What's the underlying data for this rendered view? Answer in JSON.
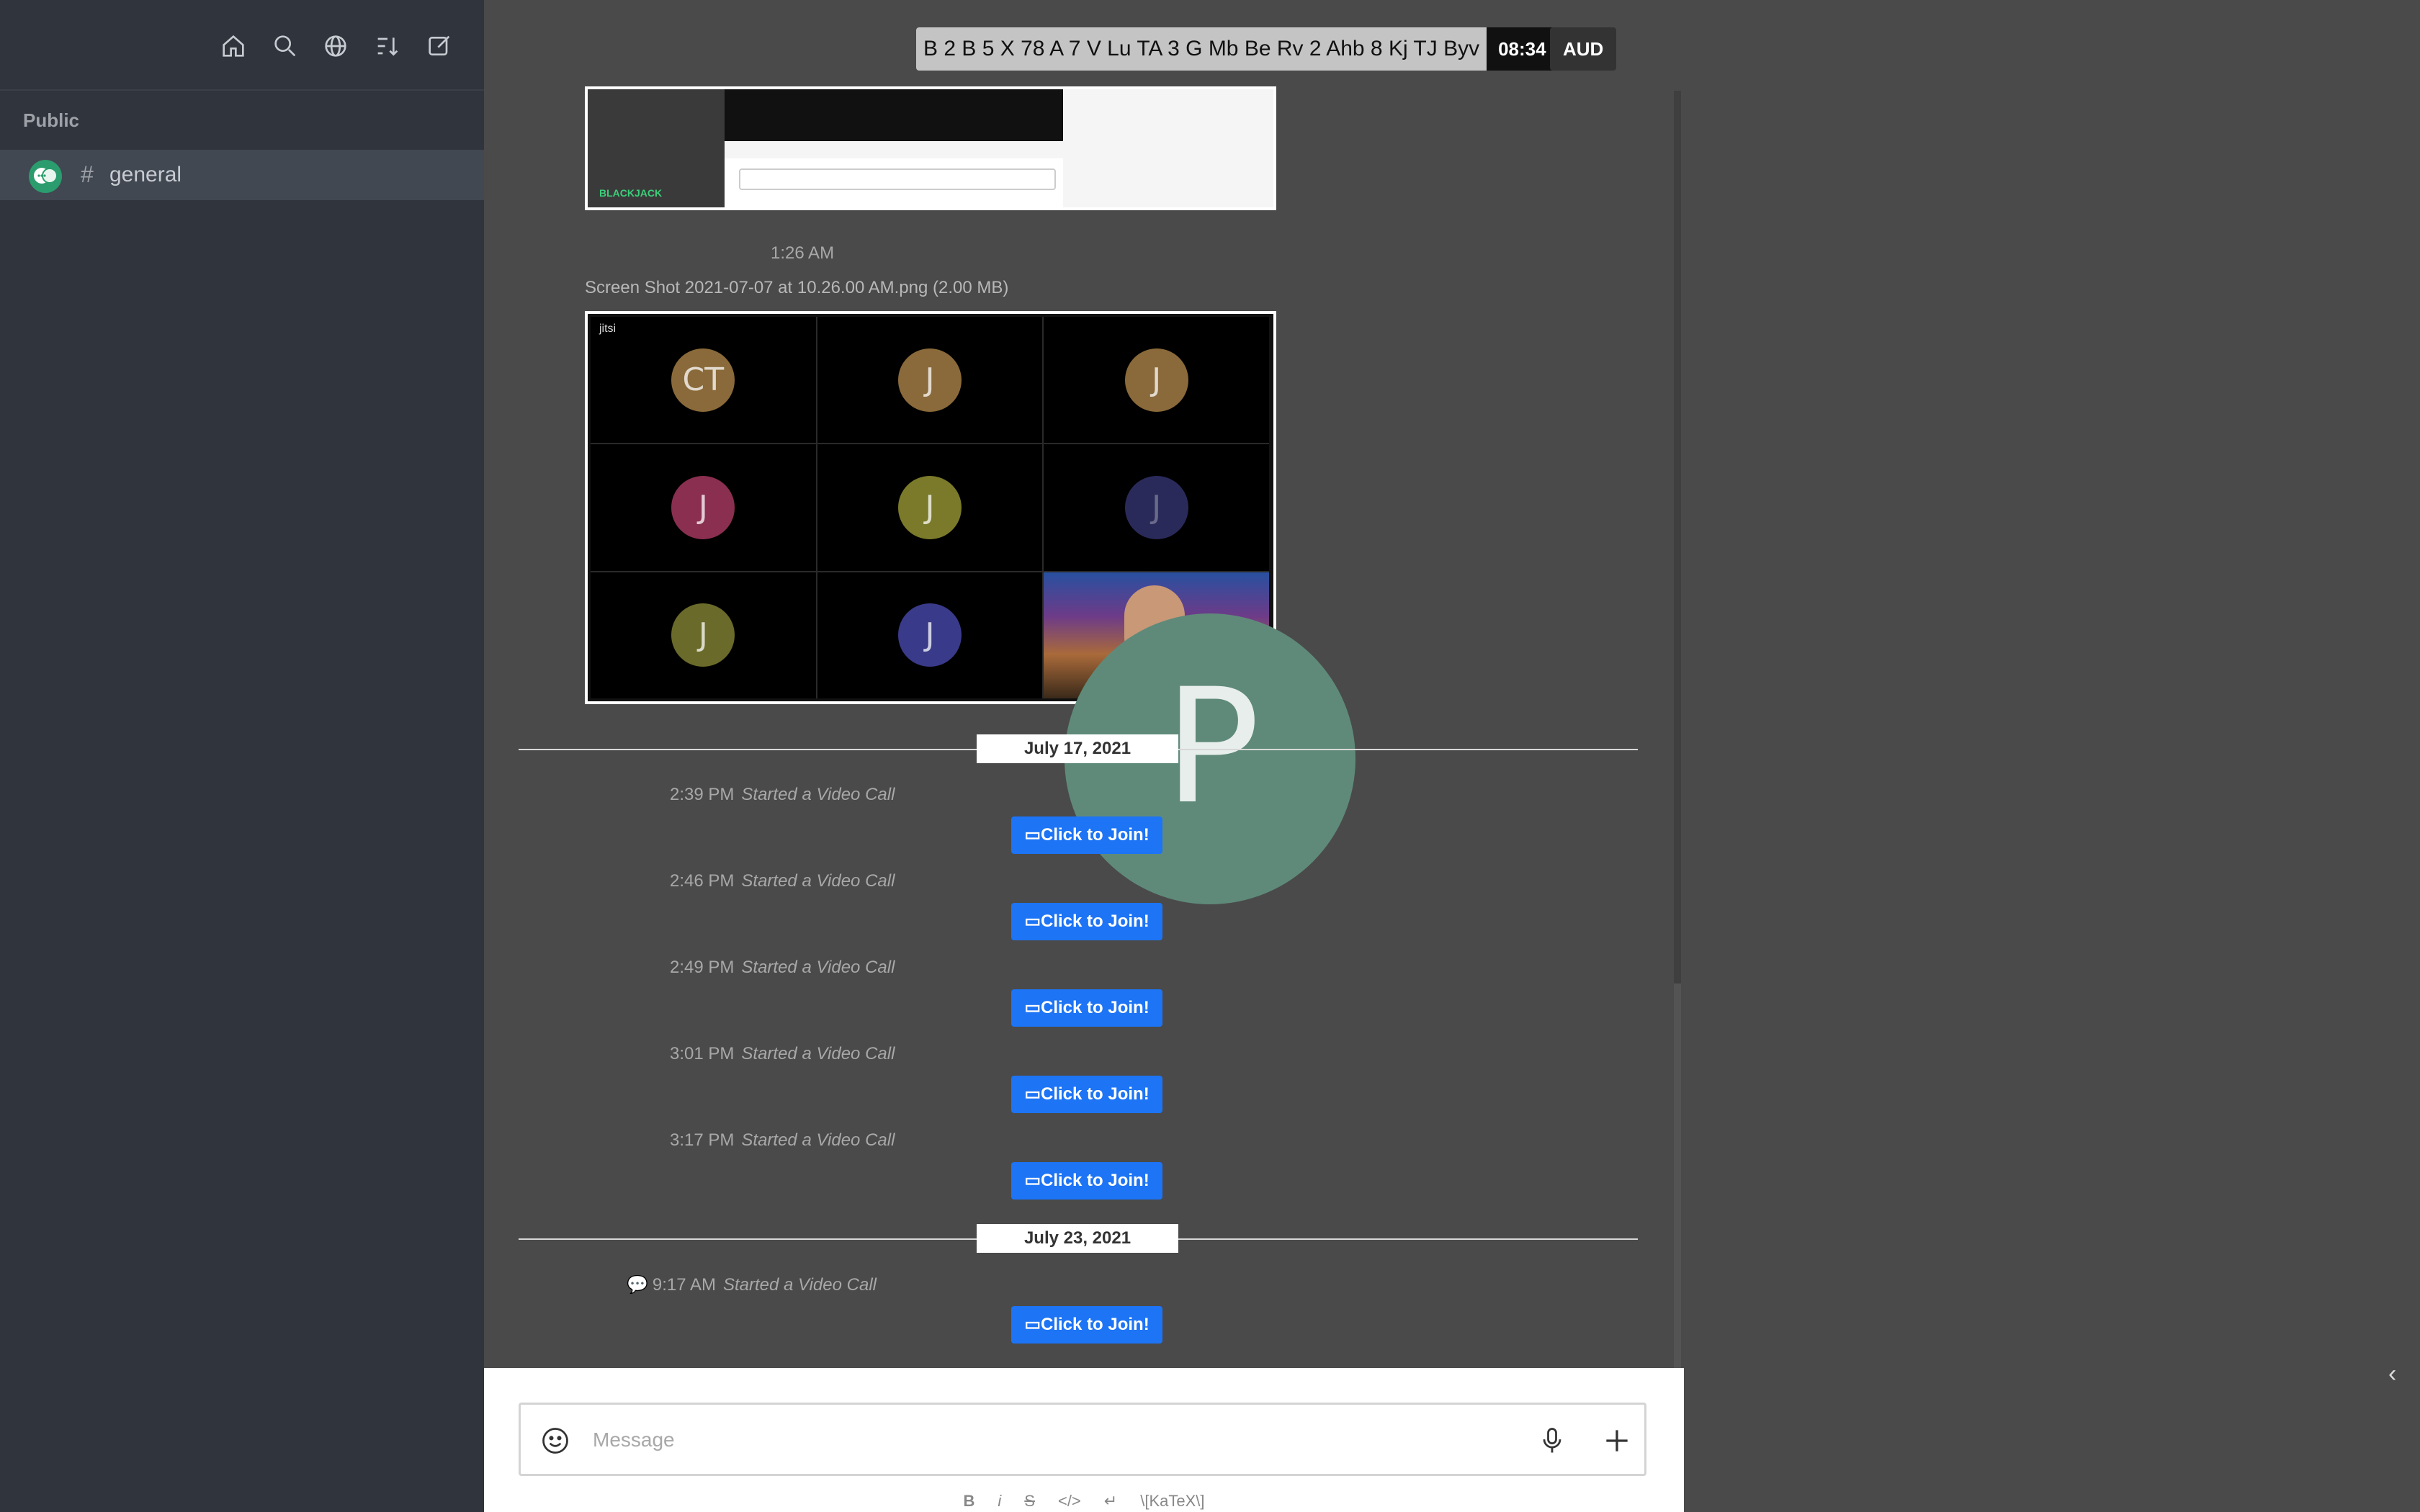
{
  "sidebar": {
    "toolbar_icons": [
      "home-icon",
      "search-icon",
      "globe-icon",
      "sort-icon",
      "pencil-icon"
    ],
    "section_title": "Public",
    "channel": {
      "hash": "#",
      "name": "general"
    }
  },
  "overlay": {
    "ticker_text": "B 2 B 5 X 78 A 7 V Lu TA 3 G Mb Be Rv 2 Ahb 8 Kj TJ Byv",
    "time": "08:34",
    "currency": "AUD"
  },
  "messages": {
    "image1": {
      "logo_text": "BLACKJACK"
    },
    "time_1": "1:26 AM",
    "file_label": "Screen Shot 2021-07-07 at 10.26.00 AM.png (2.00 MB)",
    "jitsi_label": "jitsi",
    "tiles": [
      {
        "initials": "CT",
        "color": "#8a6a3a"
      },
      {
        "initials": "J",
        "color": "#8a6a3a"
      },
      {
        "initials": "J",
        "color": "#8a6a3a"
      },
      {
        "initials": "J",
        "color": "#8a2f4f"
      },
      {
        "initials": "J",
        "color": "#7a7a2a"
      },
      {
        "initials": "J",
        "color": "#2a2a5a"
      },
      {
        "initials": "J",
        "color": "#6a6a2a"
      },
      {
        "initials": "J",
        "color": "#3a3a8a"
      }
    ],
    "avatar_letter": "P",
    "day_1": "July 17, 2021",
    "day_2": "July 23, 2021",
    "calls": [
      {
        "time": "2:39 PM",
        "desc": "Started a Video Call",
        "button": "Click to Join!"
      },
      {
        "time": "2:46 PM",
        "desc": "Started a Video Call",
        "button": "Click to Join!"
      },
      {
        "time": "2:49 PM",
        "desc": "Started a Video Call",
        "button": "Click to Join!"
      },
      {
        "time": "3:01 PM",
        "desc": "Started a Video Call",
        "button": "Click to Join!"
      },
      {
        "time": "3:17 PM",
        "desc": "Started a Video Call",
        "button": "Click to Join!"
      },
      {
        "time": "9:17 AM",
        "desc": "Started a Video Call",
        "button": "Click to Join!"
      }
    ]
  },
  "composer": {
    "placeholder": "Message",
    "format": [
      "B",
      "i",
      "S",
      "</>",
      "↵",
      "\\[KaTeX\\]"
    ]
  },
  "colors": {
    "accent": "#1d74f5",
    "sidebar": "#2f343d",
    "content": "#4a4a4a"
  }
}
